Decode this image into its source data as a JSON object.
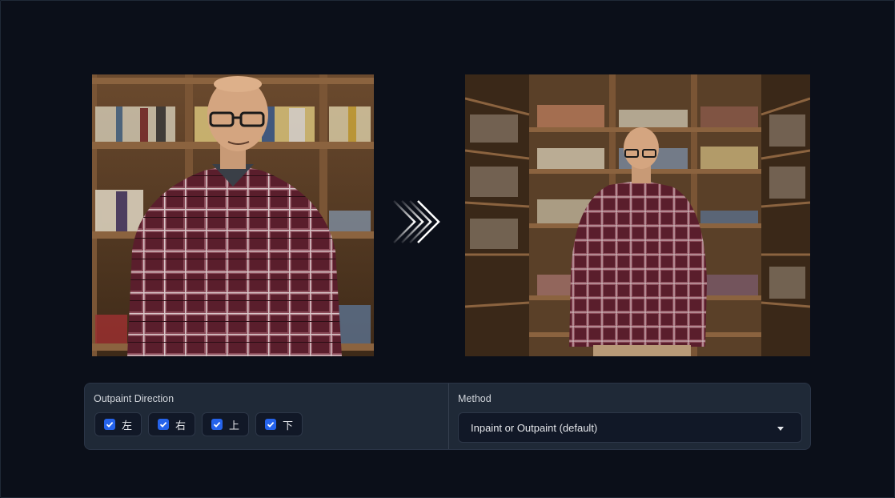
{
  "outpaint": {
    "label": "Outpaint Direction",
    "directions": [
      {
        "label": "左",
        "checked": true
      },
      {
        "label": "右",
        "checked": true
      },
      {
        "label": "上",
        "checked": true
      },
      {
        "label": "下",
        "checked": true
      }
    ]
  },
  "method": {
    "label": "Method",
    "value": "Inpaint or Outpaint (default)"
  },
  "icons": {
    "arrow": "chevron-right-icon",
    "dropdown": "chevron-down-icon",
    "check": "checkmark-icon"
  },
  "colors": {
    "background": "#0b0f19",
    "panel": "#1f2937",
    "checkbox": "#2563eb"
  }
}
